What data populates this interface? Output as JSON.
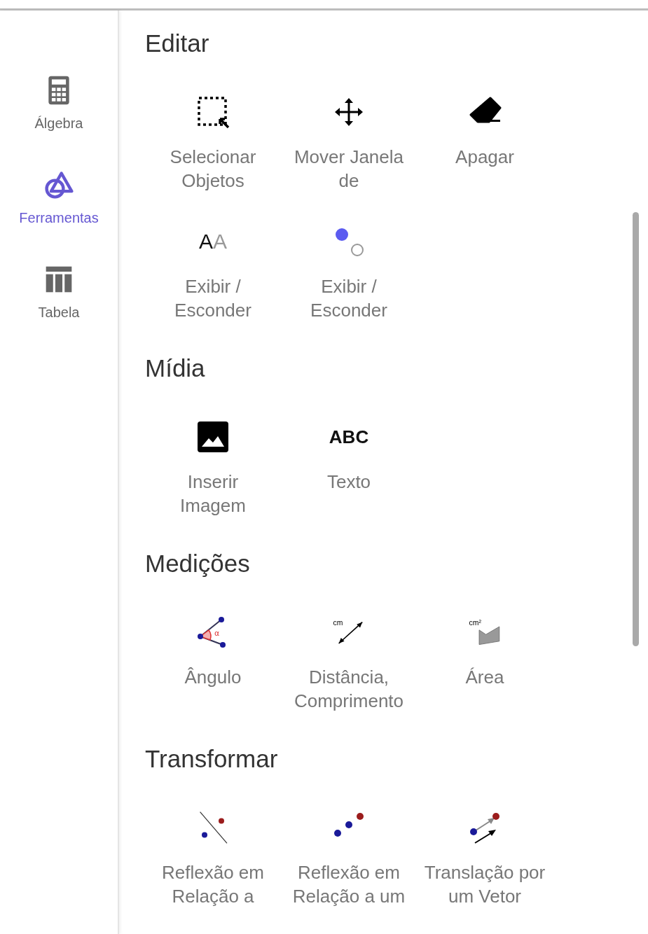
{
  "sidebar": {
    "items": [
      {
        "label": "Álgebra",
        "kind": "calculator",
        "selected": false
      },
      {
        "label": "Ferramentas",
        "kind": "shapes",
        "selected": true
      },
      {
        "label": "Tabela",
        "kind": "table",
        "selected": false
      }
    ]
  },
  "sections": [
    {
      "title": "Editar",
      "tools": [
        {
          "kind": "select",
          "label": [
            "Selecionar",
            "Objetos"
          ]
        },
        {
          "kind": "move",
          "label": [
            "Mover Janela",
            "de"
          ]
        },
        {
          "kind": "erase",
          "label": [
            "Apagar"
          ]
        },
        {
          "kind": "caption",
          "icon_text": "AA",
          "label": [
            "Exibir /",
            "Esconder"
          ]
        },
        {
          "kind": "showhide",
          "label": [
            "Exibir /",
            "Esconder"
          ]
        }
      ]
    },
    {
      "title": "Mídia",
      "tools": [
        {
          "kind": "image",
          "label": [
            "Inserir",
            "Imagem"
          ]
        },
        {
          "kind": "text",
          "icon_text": "ABC",
          "label": [
            "Texto"
          ]
        }
      ]
    },
    {
      "title": "Medições",
      "tools": [
        {
          "kind": "angle",
          "icon_text": "α",
          "label": [
            "Ângulo"
          ]
        },
        {
          "kind": "distance",
          "icon_text": "cm",
          "label": [
            "Distância,",
            "Comprimento"
          ]
        },
        {
          "kind": "area",
          "icon_text": "cm²",
          "label": [
            "Área"
          ]
        }
      ]
    },
    {
      "title": "Transformar",
      "tools": [
        {
          "kind": "reflectline",
          "label": [
            "Reflexão em",
            "Relação a"
          ]
        },
        {
          "kind": "reflectpoint",
          "label": [
            "Reflexão em",
            "Relação a um"
          ]
        },
        {
          "kind": "translate",
          "label": [
            "Translação por",
            "um Vetor"
          ]
        }
      ]
    }
  ]
}
